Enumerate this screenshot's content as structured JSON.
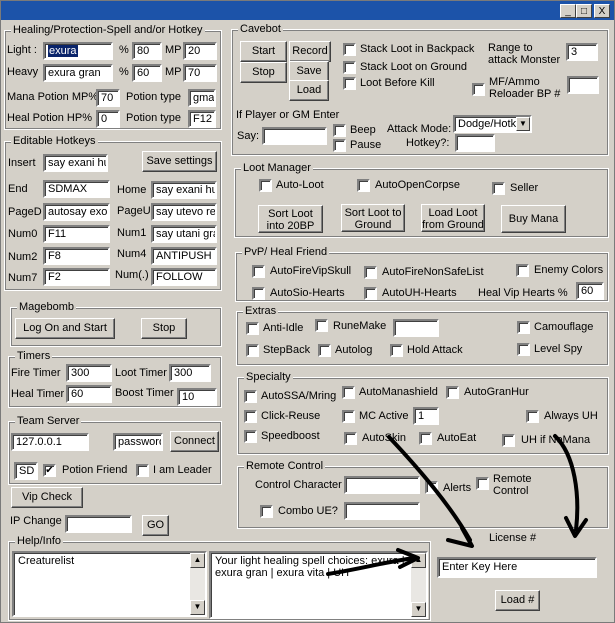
{
  "title_buttons": {
    "min": "_",
    "max": "□",
    "close": "X"
  },
  "heal": {
    "legend": "Healing/Protection-Spell and/or Hotkey",
    "light_label": "Light :",
    "light_spell": "exura",
    "light_pct_symbol": "%",
    "light_pct": "80",
    "light_mp_label": "MP",
    "light_mp": "20",
    "heavy_label": "Heavy",
    "heavy_spell": "exura gran",
    "heavy_pct_symbol": "%",
    "heavy_pct": "60",
    "heavy_mp_label": "MP",
    "heavy_mp": "70",
    "mana_potion_label": "Mana Potion MP%",
    "mana_potion_value": "70",
    "mana_potion_type_label": "Potion type",
    "mana_potion_type": "gma",
    "heal_potion_label": "Heal Potion HP%",
    "heal_potion_value": "0",
    "heal_potion_type_label": "Potion type",
    "heal_potion_type": "F12"
  },
  "hotkeys": {
    "legend": "Editable Hotkeys",
    "save": "Save settings",
    "rows": [
      {
        "l1": "Insert",
        "v1": "say exani hu",
        "l2": "",
        "v2": ""
      },
      {
        "l1": "End",
        "v1": "SDMAX",
        "l2": "Home",
        "v2": "say exani hur"
      },
      {
        "l1": "PageD",
        "v1": "autosay exori",
        "l2": "PageU",
        "v2": "say utevo re"
      },
      {
        "l1": "Num0",
        "v1": "F11",
        "l2": "Num1",
        "v2": "say utani gran"
      },
      {
        "l1": "Num2",
        "v1": "F8",
        "l2": "Num4",
        "v2": "ANTIPUSH"
      },
      {
        "l1": "Num7",
        "v1": "F2",
        "l2": "Num(.)",
        "v2": "FOLLOW"
      }
    ]
  },
  "magebomb": {
    "legend": "Magebomb",
    "logon": "Log On and Start",
    "stop": "Stop"
  },
  "timers": {
    "legend": "Timers",
    "fire_label": "Fire Timer",
    "fire": "300",
    "loot_label": "Loot Timer",
    "loot": "300",
    "heal_label": "Heal Timer",
    "heal": "60",
    "boost_label": "Boost Timer",
    "boost": "10"
  },
  "team": {
    "legend": "Team Server",
    "ip": "127.0.0.1",
    "password": "password",
    "connect": "Connect",
    "sd": "SD",
    "potion_friend": "Potion Friend",
    "leader": "I am Leader"
  },
  "vip_check": "Vip Check",
  "ip_change_label": "IP Change",
  "go": "GO",
  "help": {
    "legend": "Help/Info",
    "list": "Creaturelist",
    "info": "Your light healing spell choices: exura | exura gran | exura vita | UH"
  },
  "cavebot": {
    "legend": "Cavebot",
    "start": "Start",
    "record": "Record",
    "stop": "Stop",
    "save": "Save",
    "load": "Load",
    "stack_backpack": "Stack Loot in Backpack",
    "stack_ground": "Stack Loot on Ground",
    "loot_before_kill": "Loot Before Kill",
    "range_label": "Range to attack Monster",
    "range": "3",
    "mf_label": "MF/Ammo Reloader BP #",
    "mf": "",
    "gm_label": "If Player or GM Enter",
    "say_label": "Say:",
    "say": "",
    "beep": "Beep",
    "pause": "Pause",
    "attack_mode_label": "Attack Mode:",
    "attack_mode": "Dodge/Hotk",
    "hotkey_label": "Hotkey?:",
    "hotkey": ""
  },
  "loot": {
    "legend": "Loot Manager",
    "auto_loot": "Auto-Loot",
    "auto_open": "AutoOpenCorpse",
    "seller": "Seller",
    "sort_20bp": "Sort Loot into 20BP",
    "sort_ground": "Sort Loot to Ground",
    "load_ground": "Load Loot from Ground",
    "buy_mana": "Buy Mana"
  },
  "pvp": {
    "legend": "PvP/ Heal Friend",
    "fire_vip": "AutoFireVipSkull",
    "fire_nonsafe": "AutoFireNonSafeList",
    "enemy_colors": "Enemy Colors",
    "sio": "AutoSio-Hearts",
    "uh": "AutoUH-Hearts",
    "vip_hearts_label": "Heal Vip Hearts %",
    "vip_hearts": "60"
  },
  "extras": {
    "legend": "Extras",
    "anti_idle": "Anti-Idle",
    "rune_make": "RuneMake",
    "rune_value": "",
    "camouflage": "Camouflage",
    "stepback": "StepBack",
    "autolog": "Autolog",
    "hold_attack": "Hold Attack",
    "level_spy": "Level Spy"
  },
  "specialty": {
    "legend": "Specialty",
    "ssa": "AutoSSA/Mring",
    "manashield": "AutoManashield",
    "granhur": "AutoGranHur",
    "click_reuse": "Click-Reuse",
    "mc_active": "MC Active",
    "mc_value": "1",
    "always_uh": "Always UH",
    "speedboost": "Speedboost",
    "autoskin": "AutoSkin",
    "autoeat": "AutoEat",
    "uh_no_mana": "UH if NoMana"
  },
  "remote": {
    "legend": "Remote Control",
    "control_char": "Control Character",
    "alerts": "Alerts",
    "remote": "Remote Control",
    "combo": "Combo UE?"
  },
  "license": {
    "label": "License #",
    "placeholder": "Enter Key Here",
    "load": "Load #"
  }
}
